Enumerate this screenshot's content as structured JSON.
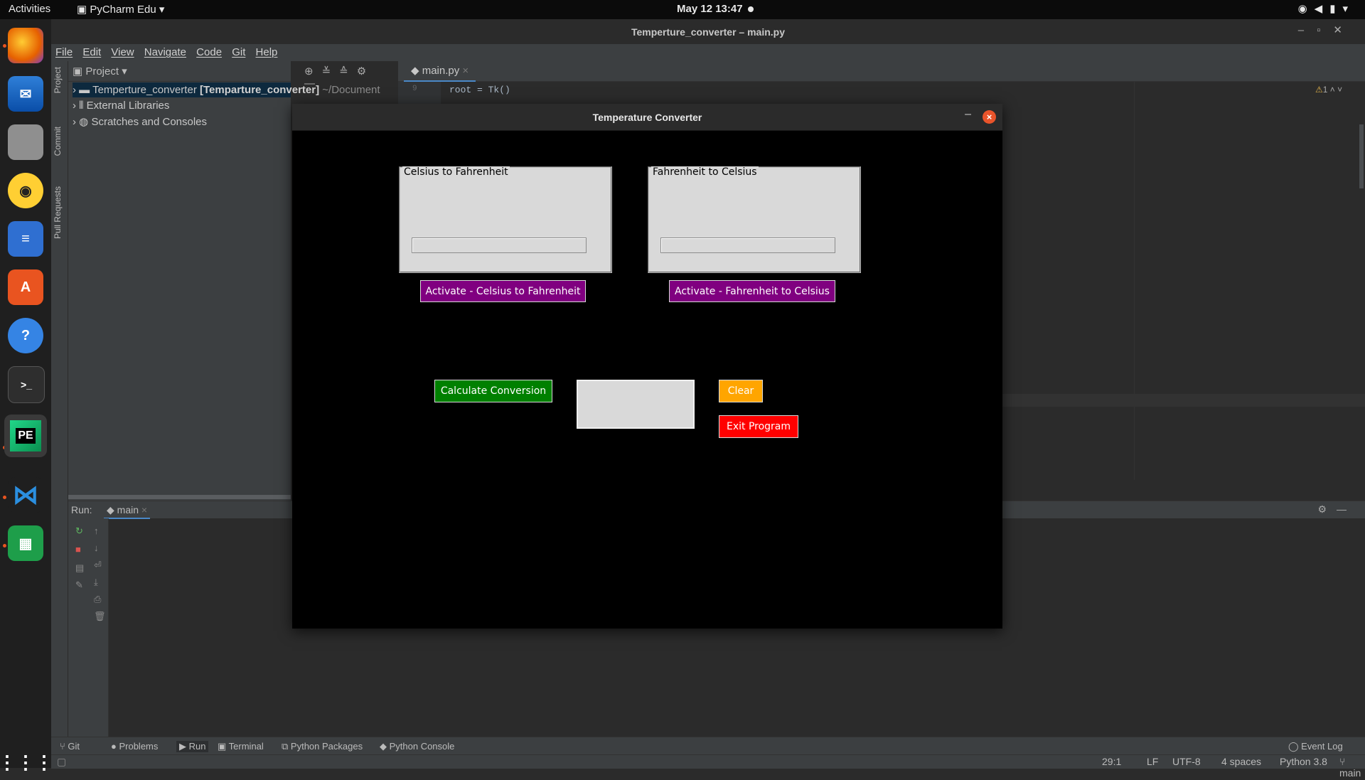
{
  "topbar": {
    "activities": "Activities",
    "app": "PyCharm Edu",
    "clock": "May 12  13:47"
  },
  "dock": {
    "items": [
      "firefox-icon",
      "thunderbird-icon",
      "files-icon",
      "rhythmbox-icon",
      "writer-icon",
      "software-icon",
      "help-icon",
      "terminal-icon",
      "pycharm-icon",
      "vscode-icon",
      "calc-icon"
    ],
    "pycharm_badge": "PE"
  },
  "ide": {
    "title": "Temperture_converter – main.py",
    "menu": [
      "File",
      "Edit",
      "View",
      "Navigate",
      "Code",
      "Git",
      "Help"
    ],
    "left_tabs": [
      "Project",
      "Commit",
      "Pull Requests"
    ]
  },
  "project": {
    "header": "Project",
    "tree": {
      "root_name": "Temperture_converter",
      "root_module": "[Temparture_converter]",
      "root_path": "~/Document",
      "external": "External Libraries",
      "scratches": "Scratches and Consoles"
    }
  },
  "editor": {
    "tab": "main.py",
    "line_number": "9",
    "code_line": "root = Tk()",
    "inspection": "1"
  },
  "run": {
    "label": "Run:",
    "config": "main"
  },
  "bottom_tools": [
    "Git",
    "Problems",
    "Run",
    "Terminal",
    "Python Packages",
    "Python Console"
  ],
  "event_log": "Event Log",
  "status": {
    "position": "29:1",
    "line_sep": "LF",
    "encoding": "UTF-8",
    "indent": "4 spaces",
    "interpreter": "Python 3.8",
    "branch": "main"
  },
  "tk": {
    "title": "Temperature Converter",
    "frame_c2f": "Celsius to Fahrenheit",
    "frame_f2c": "Fahrenheit to Celsius",
    "btn_activate_c2f": "Activate - Celsius to Fahrenheit",
    "btn_activate_f2c": "Activate - Fahrenheit to Celsius",
    "btn_calculate": "Calculate Conversion",
    "btn_clear": "Clear",
    "btn_exit": "Exit Program",
    "colors": {
      "activate": "#800080",
      "calculate": "#008000",
      "clear": "#ffa500",
      "exit": "#ff0000"
    }
  }
}
